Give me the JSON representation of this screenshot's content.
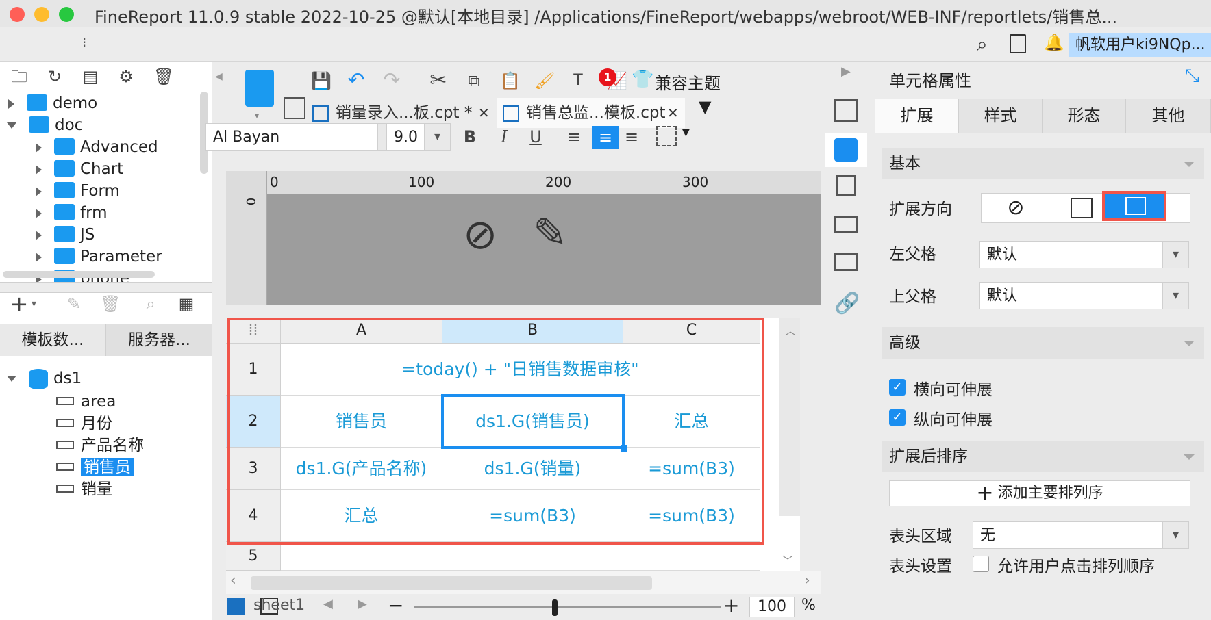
{
  "window": {
    "title": "FineReport 11.0.9 stable 2022-10-25 @默认[本地目录]   /Applications/FineReport/webapps/webroot/WEB-INF/reportlets/销售总..."
  },
  "menubar": {
    "user_label": "帆软用户ki9NQp..."
  },
  "file_tree": {
    "items": [
      {
        "label": "demo",
        "level": 0,
        "expanded": false
      },
      {
        "label": "doc",
        "level": 0,
        "expanded": true
      },
      {
        "label": "Advanced",
        "level": 1,
        "expanded": false
      },
      {
        "label": "Chart",
        "level": 1,
        "expanded": false
      },
      {
        "label": "Form",
        "level": 1,
        "expanded": false
      },
      {
        "label": "frm",
        "level": 1,
        "expanded": false
      },
      {
        "label": "JS",
        "level": 1,
        "expanded": false
      },
      {
        "label": "Parameter",
        "level": 1,
        "expanded": false
      },
      {
        "label": "phone",
        "level": 1,
        "expanded": false
      }
    ]
  },
  "dataset_panel": {
    "tabs": [
      "模板数...",
      "服务器..."
    ],
    "dataset_name": "ds1",
    "fields": [
      "area",
      "月份",
      "产品名称",
      "销售员",
      "销量"
    ],
    "selected_field": "销售员"
  },
  "toolbar": {
    "notification_count": "1",
    "theme_label": "兼容主题"
  },
  "tabs": [
    {
      "label": "销量录入...板.cpt *",
      "active": false
    },
    {
      "label": "销售总监...模板.cpt",
      "active": true
    }
  ],
  "format_bar": {
    "font_name": "Al Bayan",
    "font_size": "9.0"
  },
  "ruler": {
    "marks": [
      "0",
      "100",
      "200",
      "300"
    ],
    "vertical_mark": "0"
  },
  "grid": {
    "columns": [
      "A",
      "B",
      "C"
    ],
    "rows": [
      "1",
      "2",
      "3",
      "4",
      "5"
    ],
    "cells": {
      "r1": "=today() + \"日销售数据审核\"",
      "r2a": "销售员",
      "r2b": "ds1.G(销售员)",
      "r2c": "汇总",
      "r3a": "ds1.G(产品名称)",
      "r3b": "ds1.G(销量)",
      "r3c": "=sum(B3)",
      "r4a": "汇总",
      "r4b": "=sum(B3)",
      "r4c": "=sum(B3)"
    },
    "sheet_name": "sheet1",
    "zoom": "100",
    "zoom_unit": "%",
    "accent": "#1a9ad6",
    "highlight": "#f0554a"
  },
  "properties": {
    "panel_title": "单元格属性",
    "tabs": [
      "扩展",
      "样式",
      "形态",
      "其他"
    ],
    "active_tab": "扩展",
    "section_basic": "基本",
    "expand_direction_label": "扩展方向",
    "left_parent_label": "左父格",
    "left_parent_value": "默认",
    "top_parent_label": "上父格",
    "top_parent_value": "默认",
    "section_advanced": "高级",
    "horizontal_expand_label": "横向可伸展",
    "horizontal_expand_checked": true,
    "vertical_expand_label": "纵向可伸展",
    "vertical_expand_checked": true,
    "section_sort": "扩展后排序",
    "add_sort_label": "添加主要排列序",
    "header_area_label": "表头区域",
    "header_area_value": "无",
    "header_settings_label": "表头设置",
    "allow_sort_label": "允许用户点击排列顺序",
    "allow_sort_checked": false
  }
}
